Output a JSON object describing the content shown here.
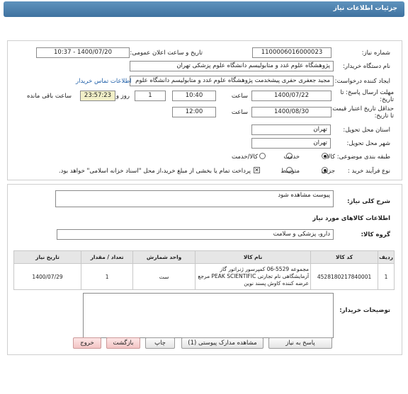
{
  "header": {
    "title": "جزئیات اطلاعات نیاز"
  },
  "form": {
    "need_number_label": "شماره نیاز:",
    "need_number": "1100006016000023",
    "announce_label": "تاریخ و ساعت اعلان عمومی:",
    "announce_value": "1400/07/20 - 10:37",
    "buyer_label": "نام دستگاه خریدار:",
    "buyer_value": "پژوهشگاه علوم غدد و متابولیسم دانشگاه علوم پزشکی تهران",
    "requester_label": "ایجاد کننده درخواست:",
    "requester_value": "مجید  جعفری حفری پیشخدمت پژوهشگاه علوم غدد و متابولیسم دانشگاه علوم",
    "contact_link": "اطلاعات تماس خریدار",
    "deadline_label": "مهلت ارسال پاسخ: تا تاریخ:",
    "deadline_date": "1400/07/22",
    "time_label": "ساعت",
    "deadline_time": "10:40",
    "days_value": "1",
    "days_label": "روز و",
    "remaining_value": "23:57:23",
    "remaining_label": "ساعت باقی مانده",
    "validity_label": "حداقل تاریخ اعتبار قیمت: تا تاریخ:",
    "validity_date": "1400/08/30",
    "validity_time_label": "ساعت",
    "validity_time": "12:00",
    "province_label": "استان محل تحویل:",
    "province_value": "تهران",
    "city_label": "شهر محل تحویل:",
    "city_value": "تهران",
    "category_label": "طبقه بندی موضوعی:",
    "category_options": [
      "کالا",
      "خدمت",
      "کالا/خدمت"
    ],
    "process_label": "نوع فرآیند خرید :",
    "process_options": [
      "جزیی",
      "متوسط"
    ],
    "payment_note": "پرداخت تمام یا بخشی از مبلغ خرید،از محل \"اسناد خزانه اسلامی\" خواهد بود."
  },
  "summary": {
    "label": "شرح کلی نیاز:",
    "value": "پیوست مشاهده شود"
  },
  "goods": {
    "section_title": "اطلاعات کالاهای مورد نیاز",
    "group_label": "گروه کالا:",
    "group_value": "دارو، پزشکی و سلامت",
    "columns": [
      "ردیف",
      "کد کالا",
      "نام کالا",
      "واحد شمارش",
      "تعداد / مقدار",
      "تاریخ نیاز"
    ],
    "rows": [
      {
        "row": "1",
        "code": "4528180217840001",
        "name": "مجموعه 5529-06 کمپرسور ژنراتور گاز آزمایشگاهی نام تجارتی PEAK SCIENTIFIC مرجع عرضه کننده کاوش پسند نوین",
        "unit": "ست",
        "qty": "1",
        "date": "1400/07/29"
      }
    ]
  },
  "notes": {
    "label": "توضیحات خریدار:",
    "value": ""
  },
  "buttons": {
    "reply": "پاسخ به نیاز",
    "attachments": "مشاهده مدارک پیوستی (1)",
    "print": "چاپ",
    "back": "بازگشت",
    "exit": "خروج"
  }
}
